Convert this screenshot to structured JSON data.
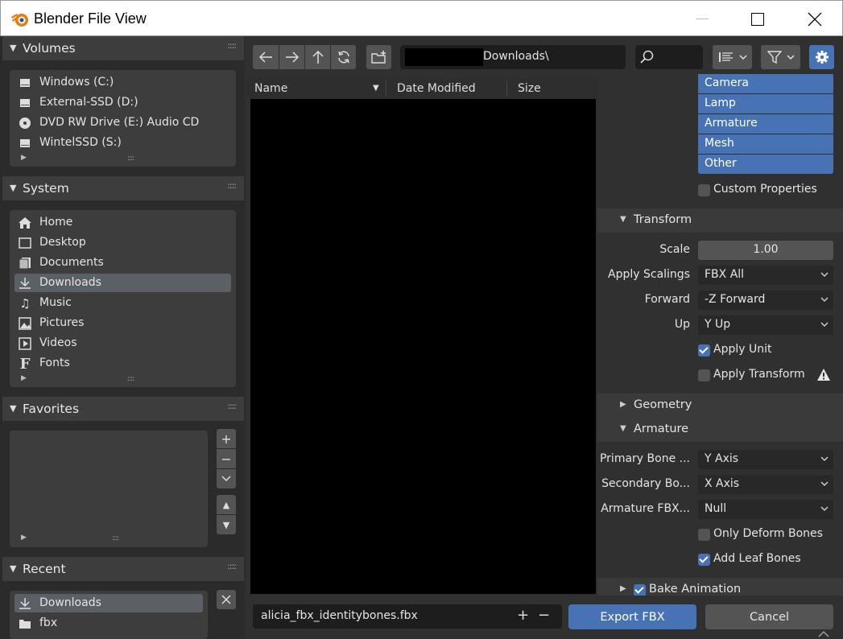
{
  "window": {
    "title": "Blender File View"
  },
  "sidebar": {
    "volumes": {
      "title": "Volumes",
      "items": [
        {
          "label": "Windows (C:)",
          "icon": "disk-icon"
        },
        {
          "label": "External-SSD (D:)",
          "icon": "disk-icon"
        },
        {
          "label": "DVD RW Drive (E:) Audio CD",
          "icon": "disc-icon"
        },
        {
          "label": "WintelSSD (S:)",
          "icon": "disk-icon"
        }
      ]
    },
    "system": {
      "title": "System",
      "items": [
        {
          "label": "Home",
          "icon": "home-icon"
        },
        {
          "label": "Desktop",
          "icon": "desktop-icon"
        },
        {
          "label": "Documents",
          "icon": "documents-icon"
        },
        {
          "label": "Downloads",
          "icon": "download-icon",
          "active": true
        },
        {
          "label": "Music",
          "icon": "music-icon"
        },
        {
          "label": "Pictures",
          "icon": "pictures-icon"
        },
        {
          "label": "Videos",
          "icon": "videos-icon"
        },
        {
          "label": "Fonts",
          "icon": "fonts-icon"
        }
      ]
    },
    "favorites": {
      "title": "Favorites"
    },
    "recent": {
      "title": "Recent",
      "items": [
        {
          "label": "Downloads",
          "icon": "download-icon",
          "active": true
        },
        {
          "label": "fbx",
          "icon": "folder-icon"
        }
      ]
    }
  },
  "toolbar": {
    "path": "Downloads\\"
  },
  "columns": {
    "name": "Name",
    "date_modified": "Date Modified",
    "size": "Size"
  },
  "properties": {
    "object_types": [
      "Camera",
      "Lamp",
      "Armature",
      "Mesh",
      "Other"
    ],
    "custom_properties": {
      "label": "Custom Properties",
      "checked": false
    },
    "transform": {
      "title": "Transform",
      "scale_label": "Scale",
      "scale_value": "1.00",
      "apply_scalings_label": "Apply Scalings",
      "apply_scalings_value": "FBX All",
      "forward_label": "Forward",
      "forward_value": "-Z Forward",
      "up_label": "Up",
      "up_value": "Y Up",
      "apply_unit": {
        "label": "Apply Unit",
        "checked": true
      },
      "apply_transform": {
        "label": "Apply Transform",
        "checked": false
      }
    },
    "geometry": {
      "title": "Geometry"
    },
    "armature": {
      "title": "Armature",
      "primary_bone_label": "Primary Bone ...",
      "primary_bone_value": "Y Axis",
      "secondary_bone_label": "Secondary Bo...",
      "secondary_bone_value": "X Axis",
      "armature_fbx_label": "Armature FBX...",
      "armature_fbx_value": "Null",
      "only_deform": {
        "label": "Only Deform Bones",
        "checked": false
      },
      "add_leaf": {
        "label": "Add Leaf Bones",
        "checked": true
      }
    },
    "bake_animation": {
      "label": "Bake Animation",
      "checked": true
    }
  },
  "bottom": {
    "filename": "alicia_fbx_identitybones.fbx",
    "export_label": "Export FBX",
    "cancel_label": "Cancel"
  },
  "colors": {
    "accent": "#4772b3",
    "panel": "#3d3d3d",
    "background": "#303030"
  }
}
